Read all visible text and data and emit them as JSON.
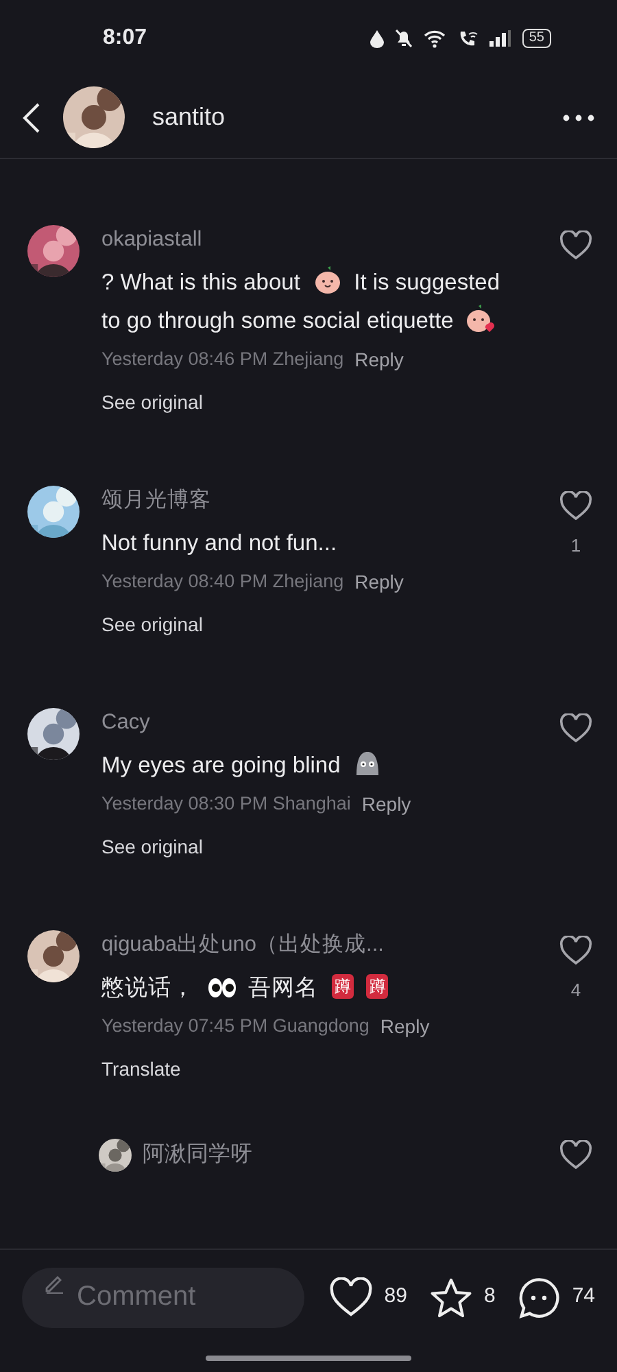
{
  "status_bar": {
    "time": "8:07",
    "battery": "55"
  },
  "header": {
    "username": "santito"
  },
  "comments": [
    {
      "user": "okapiastall",
      "parts": [
        {
          "kind": "text",
          "text": "? What is this about"
        },
        {
          "kind": "peach"
        },
        {
          "kind": "text",
          "text": "It is suggested"
        },
        {
          "kind": "text",
          "text": "to go through some social etiquette"
        },
        {
          "kind": "peach-kiss"
        }
      ],
      "meta": "Yesterday 08:46 PM Zhejiang",
      "reply": "Reply",
      "action": "See original"
    },
    {
      "user": "颂月光博客",
      "parts": [
        {
          "kind": "text",
          "text": "Not funny and not fun..."
        }
      ],
      "meta": "Yesterday 08:40 PM Zhejiang",
      "reply": "Reply",
      "action": "See original",
      "likes": "1"
    },
    {
      "user": "Cacy",
      "parts": [
        {
          "kind": "text",
          "text": "My eyes are going blind"
        },
        {
          "kind": "ghost"
        }
      ],
      "meta": "Yesterday 08:30 PM Shanghai",
      "reply": "Reply",
      "action": "See original"
    },
    {
      "user": "qiguaba出处uno（出处换成...",
      "parts": [
        {
          "kind": "text",
          "text": "憋说话，"
        },
        {
          "kind": "eyes"
        },
        {
          "kind": "text",
          "text": "吾网名"
        },
        {
          "kind": "badge",
          "text": "蹲"
        },
        {
          "kind": "badge",
          "text": "蹲"
        }
      ],
      "meta": "Yesterday 07:45 PM Guangdong",
      "reply": "Reply",
      "action": "Translate",
      "likes": "4"
    }
  ],
  "sub_reply": {
    "user": "阿湫同学呀"
  },
  "bottom_bar": {
    "placeholder": "Comment",
    "likes": "89",
    "favorites": "8",
    "comments": "74"
  }
}
